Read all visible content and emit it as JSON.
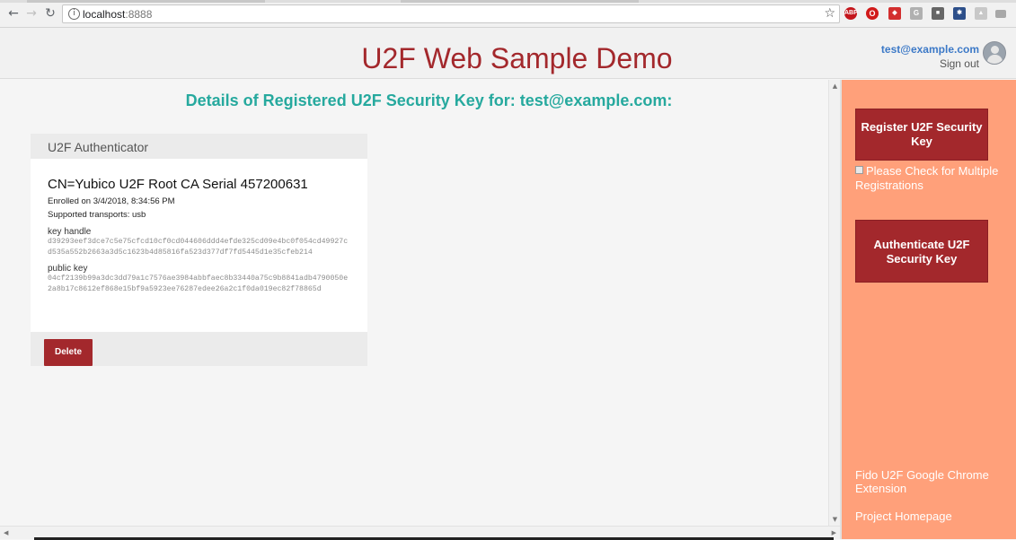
{
  "browser": {
    "url_host": "localhost",
    "url_port": ":8888"
  },
  "header": {
    "title": "U2F Web Sample Demo",
    "user_email": "test@example.com",
    "sign_out": "Sign out"
  },
  "main": {
    "heading": "Details of Registered U2F Security Key for: test@example.com:",
    "card": {
      "title": "U2F Authenticator",
      "cn": "CN=Yubico U2F Root CA Serial 457200631",
      "enrolled": "Enrolled on 3/4/2018, 8:34:56 PM",
      "transports": "Supported transports: usb",
      "key_handle_label": "key handle",
      "key_handle": "d39293eef3dce7c5e75cfcd10cf0cd044606ddd4efde325cd09e4bc0f054cd49927cd535a552b2663a3d5c1623b4d85816fa523d377df7fd5445d1e35cfeb214",
      "public_key_label": "public key",
      "public_key": "04cf2139b99a3dc3dd79a1c7576ae3984abbfaec8b33440a75c9b8841adb4790050e2a8b17c8612ef868e15bf9a5923ee76287edee26a2c1f0da019ec82f78865d",
      "delete_label": "Delete"
    }
  },
  "sidebar": {
    "register_label": "Register U2F Security Key",
    "multiple_label": "Please Check for Multiple Registrations",
    "authenticate_label": "Authenticate U2F Security Key",
    "extension_link": "Fido U2F Google Chrome Extension",
    "homepage_link": "Project Homepage"
  },
  "colors": {
    "brand_red": "#a3282c",
    "heading_teal": "#26a99e",
    "sidebar_salmon": "#ffa07a"
  }
}
